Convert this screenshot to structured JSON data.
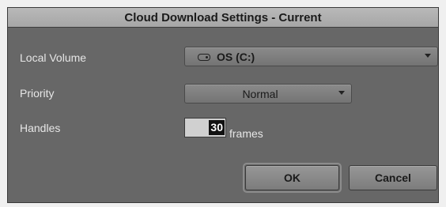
{
  "window": {
    "title": "Cloud Download Settings - Current"
  },
  "local_volume": {
    "label": "Local Volume",
    "value": "OS (C:)",
    "icon": "drive-icon"
  },
  "priority": {
    "label": "Priority",
    "value": "Normal"
  },
  "handles": {
    "label": "Handles",
    "value": "30",
    "unit": "frames"
  },
  "buttons": {
    "ok": "OK",
    "cancel": "Cancel"
  }
}
